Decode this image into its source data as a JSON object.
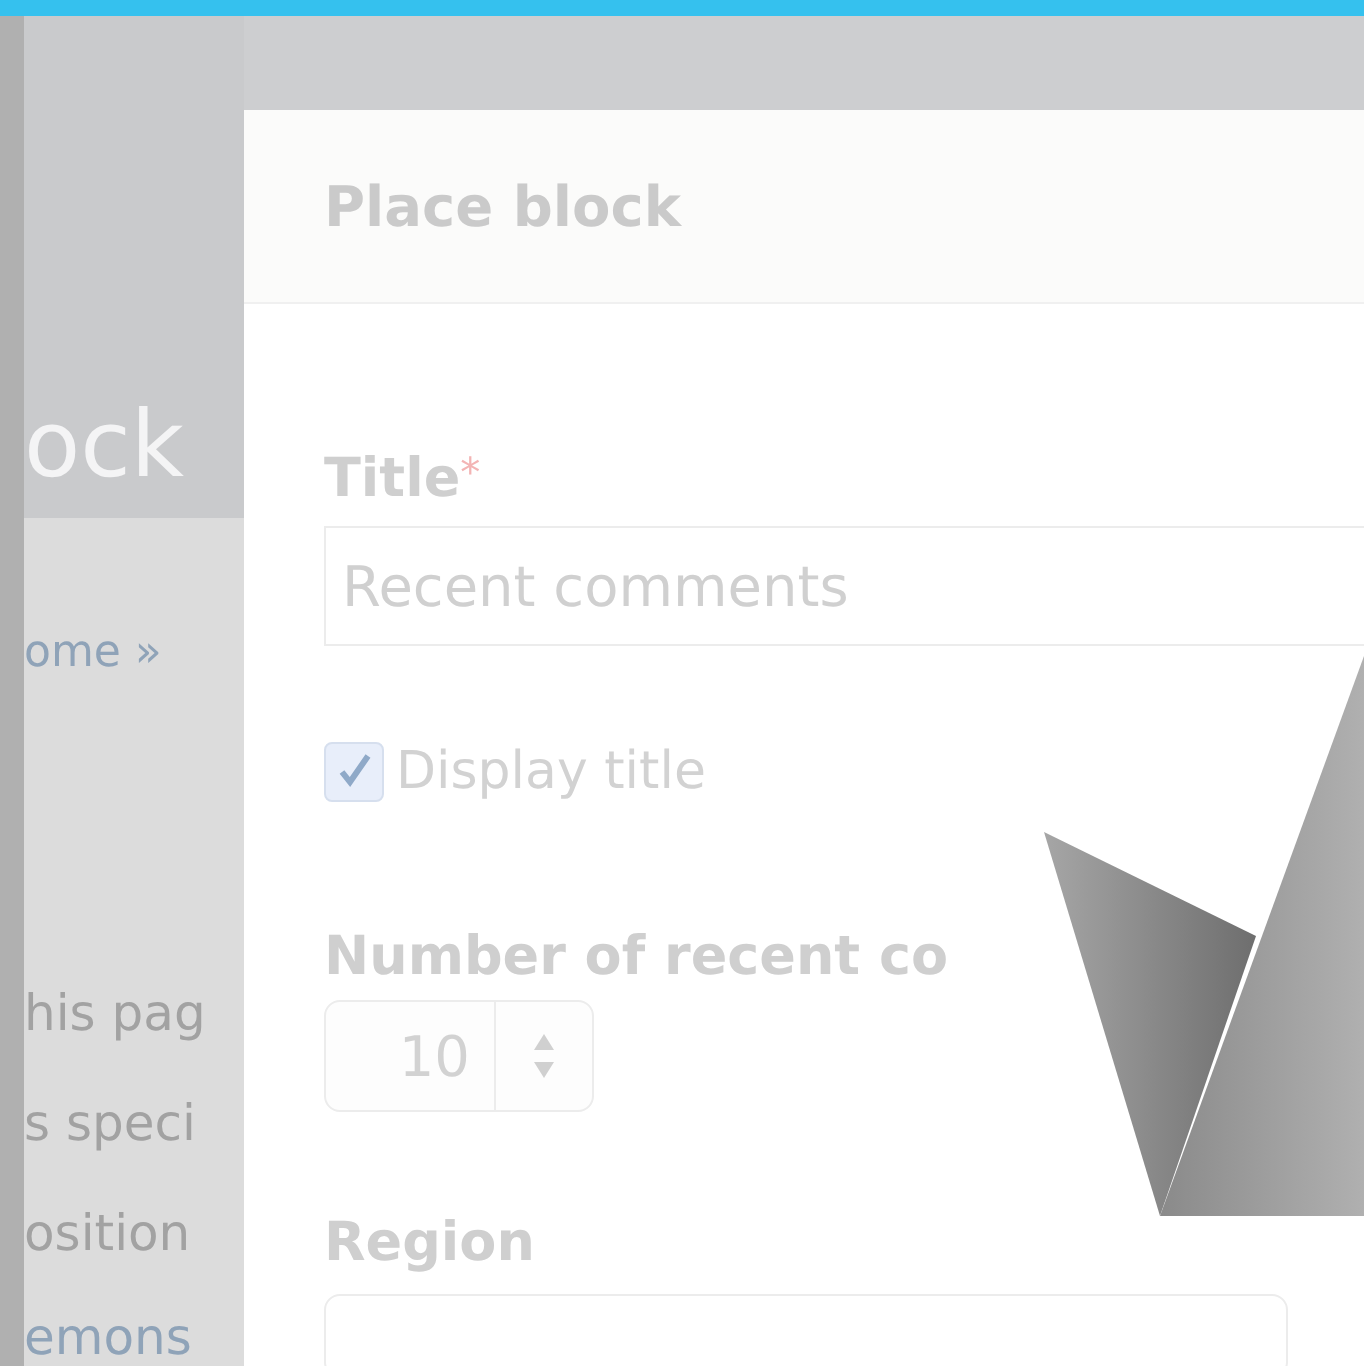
{
  "background_page": {
    "heading": "ock",
    "breadcrumb": "ome »",
    "paragraph_lines": [
      "his pag",
      "s speci",
      "osition"
    ],
    "link": "emons"
  },
  "dialog": {
    "title": "Place block",
    "fields": [
      {
        "kind": "text",
        "label": "Title",
        "required_mark": "*",
        "value": "Recent comments"
      },
      {
        "kind": "checkbox",
        "label": "Display title",
        "checked": true
      },
      {
        "kind": "number",
        "label": "Number of recent co",
        "value": "10"
      },
      {
        "kind": "select",
        "label": "Region"
      }
    ]
  }
}
